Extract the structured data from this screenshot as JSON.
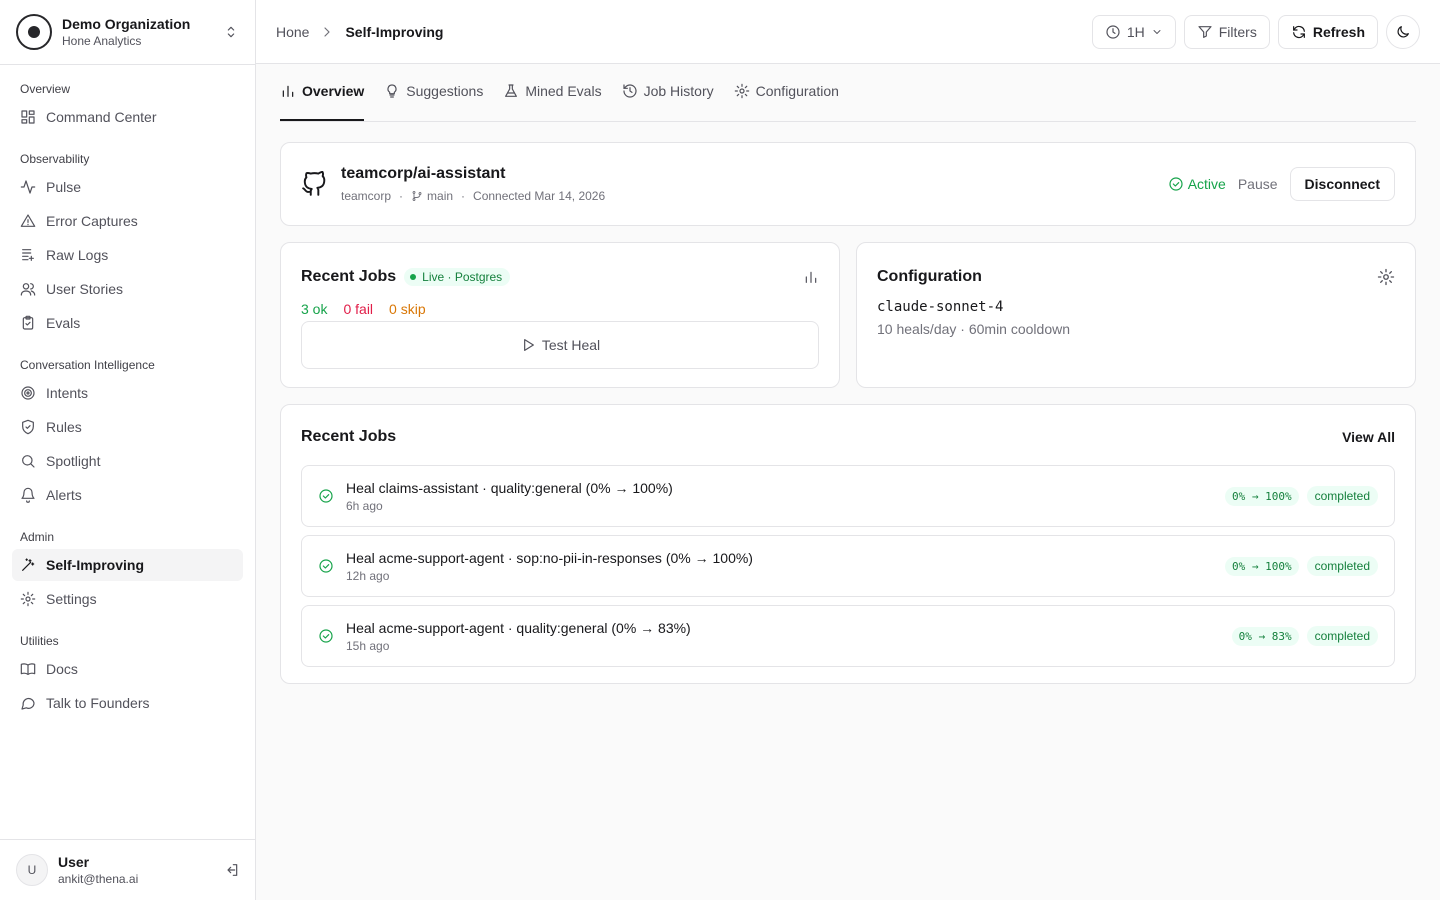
{
  "org": {
    "name": "Demo Organization",
    "subtitle": "Hone Analytics"
  },
  "sidebar": {
    "groups": [
      {
        "label": "Overview",
        "items": [
          {
            "label": "Command Center",
            "icon": "dashboard-icon"
          }
        ]
      },
      {
        "label": "Observability",
        "items": [
          {
            "label": "Pulse",
            "icon": "activity-icon"
          },
          {
            "label": "Error Captures",
            "icon": "warning-triangle-icon"
          },
          {
            "label": "Raw Logs",
            "icon": "logs-icon"
          },
          {
            "label": "User Stories",
            "icon": "users-icon"
          },
          {
            "label": "Evals",
            "icon": "clipboard-check-icon"
          }
        ]
      },
      {
        "label": "Conversation Intelligence",
        "items": [
          {
            "label": "Intents",
            "icon": "target-icon"
          },
          {
            "label": "Rules",
            "icon": "shield-check-icon"
          },
          {
            "label": "Spotlight",
            "icon": "search-icon"
          },
          {
            "label": "Alerts",
            "icon": "bell-icon"
          }
        ]
      },
      {
        "label": "Admin",
        "items": [
          {
            "label": "Self-Improving",
            "icon": "magic-wand-icon",
            "active": true
          },
          {
            "label": "Settings",
            "icon": "gear-icon"
          }
        ]
      },
      {
        "label": "Utilities",
        "items": [
          {
            "label": "Docs",
            "icon": "book-icon"
          },
          {
            "label": "Talk to Founders",
            "icon": "chat-bubble-icon"
          }
        ]
      }
    ]
  },
  "user": {
    "initial": "U",
    "name": "User",
    "email": "ankit@thena.ai"
  },
  "header": {
    "breadcrumb_home": "Hone",
    "breadcrumb_current": "Self-Improving",
    "time_range": "1H",
    "filters_label": "Filters",
    "refresh_label": "Refresh"
  },
  "tabs": [
    {
      "label": "Overview",
      "icon": "bar-chart-icon",
      "active": true
    },
    {
      "label": "Suggestions",
      "icon": "lightbulb-icon"
    },
    {
      "label": "Mined Evals",
      "icon": "flask-icon"
    },
    {
      "label": "Job History",
      "icon": "history-icon"
    },
    {
      "label": "Configuration",
      "icon": "gear-icon"
    }
  ],
  "repo": {
    "name": "teamcorp/ai-assistant",
    "owner": "teamcorp",
    "branch": "main",
    "connected": "Connected Mar 14, 2026",
    "status": "Active",
    "pause_label": "Pause",
    "disconnect_label": "Disconnect"
  },
  "jobs_summary": {
    "title": "Recent Jobs",
    "badge": "Live · Postgres",
    "ok": "3 ok",
    "fail": "0 fail",
    "skip": "0 skip",
    "test_heal_label": "Test Heal"
  },
  "config": {
    "title": "Configuration",
    "model": "claude-sonnet-4",
    "meta": "10 heals/day · 60min cooldown"
  },
  "recent_jobs": {
    "title": "Recent Jobs",
    "view_all": "View All",
    "rows": [
      {
        "title": "Heal claims-assistant · quality:general (0% → 100%)",
        "time": "6h ago",
        "delta": "0% → 100%",
        "status": "completed"
      },
      {
        "title": "Heal acme-support-agent · sop:no-pii-in-responses (0% → 100%)",
        "time": "12h ago",
        "delta": "0% → 100%",
        "status": "completed"
      },
      {
        "title": "Heal acme-support-agent · quality:general (0% → 83%)",
        "time": "15h ago",
        "delta": "0% → 83%",
        "status": "completed"
      }
    ]
  },
  "colors": {
    "success": "#16a34a",
    "danger": "#e11d48",
    "warning": "#d97706",
    "border": "#e4e4e7"
  }
}
